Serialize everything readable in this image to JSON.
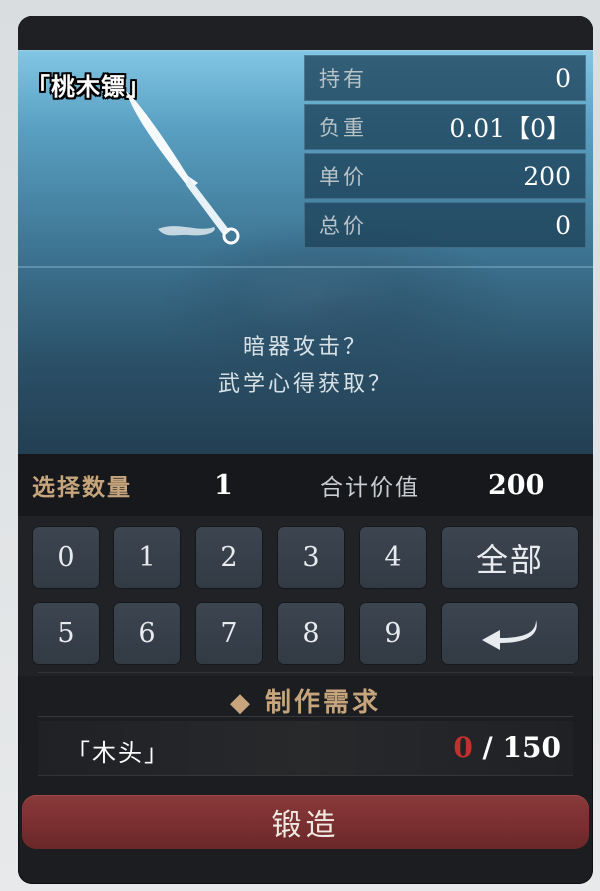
{
  "item": {
    "name": "「桃木镖」",
    "icon": "brush-icon"
  },
  "stats": [
    {
      "label": "持有",
      "value": "0"
    },
    {
      "label": "负重",
      "value": "0.01【0】"
    },
    {
      "label": "单价",
      "value": "200"
    },
    {
      "label": "总价",
      "value": "0"
    }
  ],
  "description": {
    "line1": "暗器攻击？",
    "line2": "武学心得获取？"
  },
  "quantity": {
    "label": "选择数量",
    "value": "1",
    "total_label": "合计价值",
    "total_value": "200"
  },
  "keypad": {
    "digits": [
      "0",
      "1",
      "2",
      "3",
      "4",
      "5",
      "6",
      "7",
      "8",
      "9"
    ],
    "all_label": "全部",
    "backspace_icon": "backspace-arrow-icon"
  },
  "requirements": {
    "header": "◆ 制作需求",
    "material_name": "「木头」",
    "have": "0",
    "separator": " / ",
    "need": "150"
  },
  "forge_button": "锻造",
  "colors": {
    "accent_gold": "#c7a57c",
    "shortage_red": "#c3312f",
    "forge_red": "#7a2f30"
  }
}
